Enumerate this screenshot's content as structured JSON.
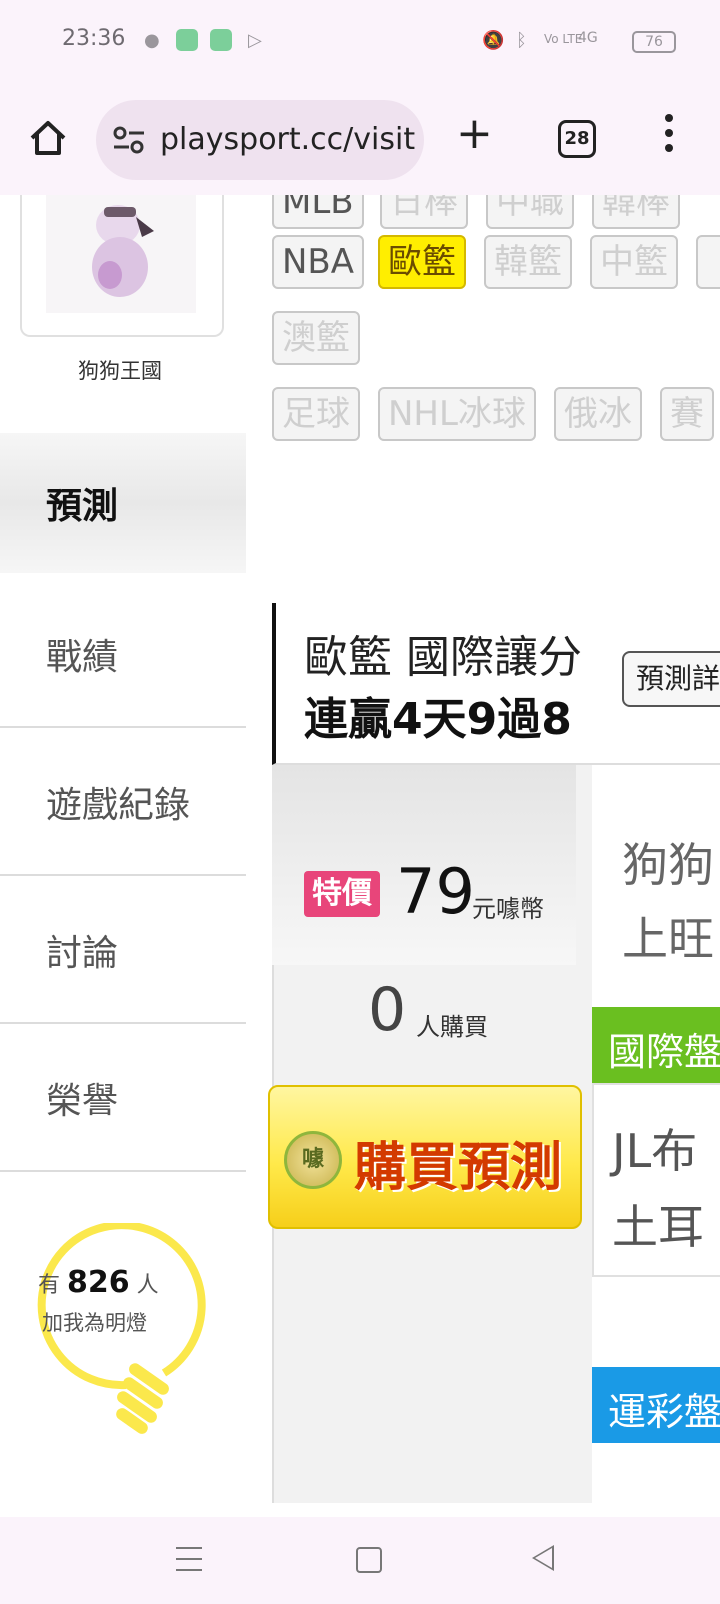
{
  "status_bar": {
    "time": "23:36",
    "battery": "76",
    "network": "4G",
    "volte": "Vo LTE"
  },
  "browser": {
    "url": "playsport.cc/visit",
    "tab_count": "28",
    "new_tab_label": "+"
  },
  "sidebar": {
    "dog_name": "狗狗王國",
    "section_title": "預測",
    "menu_items": [
      {
        "label": "戰績"
      },
      {
        "label": "遊戲紀錄"
      },
      {
        "label": "討論"
      },
      {
        "label": "榮譽"
      }
    ],
    "fans": {
      "prefix": "有",
      "count": "826",
      "suffix": "人",
      "line2": "加我為明燈"
    }
  },
  "league_tags": {
    "row0": [
      "MLB",
      "日棒",
      "中職",
      "韓棒"
    ],
    "row1": [
      "NBA",
      "歐籃",
      "韓籃",
      "中籃"
    ],
    "row2": [
      "澳籃"
    ],
    "row3": [
      "足球",
      "NHL冰球",
      "俄冰",
      "賽"
    ],
    "selected": "歐籃"
  },
  "prediction": {
    "line1": "歐籃 國際讓分",
    "line2": "連贏4天9過8",
    "button": "預測詳",
    "badge": "特價",
    "price": "79",
    "price_unit": "元噱幣",
    "buyers": "0",
    "buyers_unit": "人購買",
    "buy_button": "購買預測",
    "coin_glyph": "噱",
    "seller_line1": "狗狗",
    "seller_line2": "上旺",
    "intl_label": "國際盤",
    "team1": "JL布",
    "team2": "土耳",
    "sport_lottery_label": "運彩盤"
  },
  "colors": {
    "accent_yellow": "#ffee00",
    "badge_pink": "#e8457a",
    "green": "#6abf20",
    "blue": "#1a9ae6"
  }
}
